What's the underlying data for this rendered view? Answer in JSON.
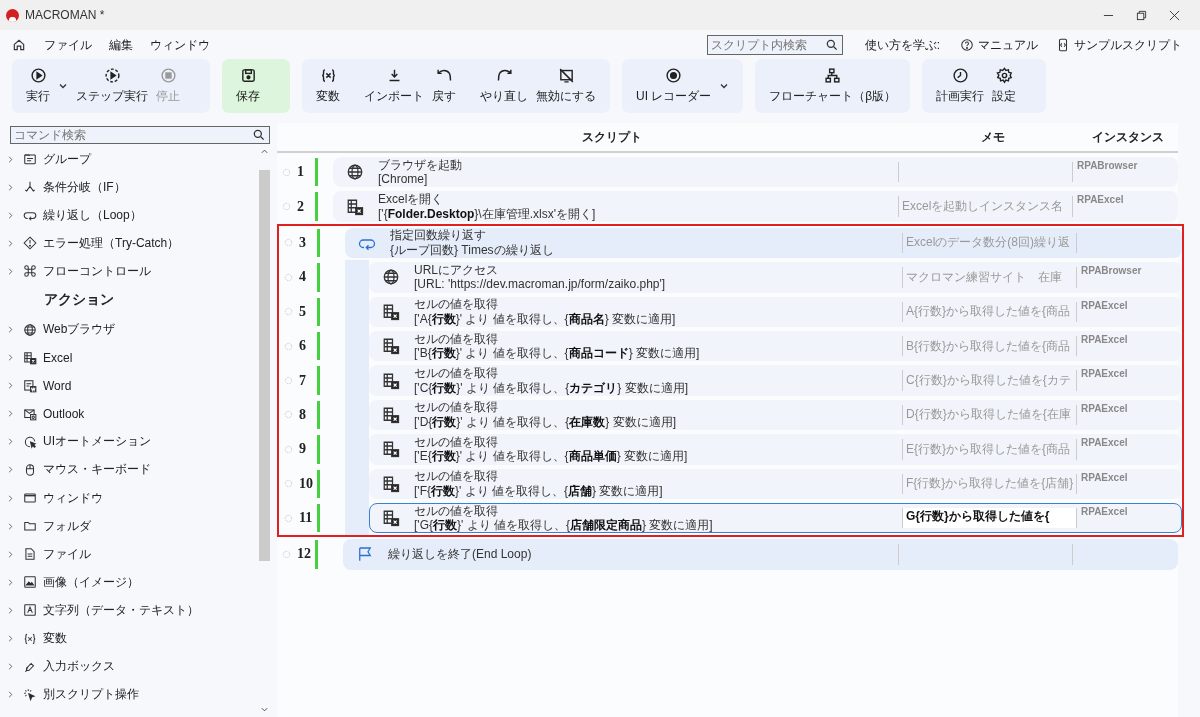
{
  "window": {
    "title": "MACROMAN *"
  },
  "menu": [
    "ファイル",
    "編集",
    "ウィンドウ"
  ],
  "script_search": {
    "placeholder": "スクリプト内検索"
  },
  "learn": {
    "label": "使い方を学ぶ:",
    "links": [
      {
        "kind": "help",
        "label": "マニュアル"
      },
      {
        "kind": "sample",
        "label": "サンプルスクリプト"
      }
    ]
  },
  "toolbar": [
    {
      "highlighted": false,
      "buttons": [
        {
          "kind": "run",
          "label": "実行",
          "dropdown": true,
          "disabled": false
        },
        {
          "kind": "step",
          "label": "ステップ実行",
          "dropdown": false,
          "disabled": false
        },
        {
          "kind": "stop",
          "label": "停止",
          "dropdown": false,
          "disabled": true
        }
      ]
    },
    {
      "highlighted": true,
      "buttons": [
        {
          "kind": "save",
          "label": "保存",
          "dropdown": false,
          "disabled": false
        }
      ]
    },
    {
      "highlighted": false,
      "buttons": [
        {
          "kind": "variable",
          "label": "変数",
          "dropdown": false,
          "disabled": false
        },
        {
          "kind": "import",
          "label": "インポート",
          "dropdown": false,
          "disabled": false
        },
        {
          "kind": "undo",
          "label": "戻す",
          "dropdown": false,
          "disabled": false
        },
        {
          "kind": "redo",
          "label": "やり直し",
          "dropdown": false,
          "disabled": false
        },
        {
          "kind": "disable",
          "label": "無効にする",
          "dropdown": false,
          "disabled": false
        }
      ]
    },
    {
      "highlighted": false,
      "buttons": [
        {
          "kind": "record",
          "label": "UI レコーダー",
          "dropdown": true,
          "disabled": false
        }
      ]
    },
    {
      "highlighted": false,
      "buttons": [
        {
          "kind": "flow",
          "label": "フローチャート（β版）",
          "dropdown": false,
          "disabled": false
        }
      ]
    },
    {
      "highlighted": false,
      "buttons": [
        {
          "kind": "schedule",
          "label": "計画実行",
          "dropdown": false,
          "disabled": false
        },
        {
          "kind": "settings",
          "label": "設定",
          "dropdown": false,
          "disabled": false
        }
      ]
    }
  ],
  "sidebar": {
    "search": {
      "placeholder": "コマンド検索"
    },
    "items": [
      {
        "kind": "group",
        "label": "グループ",
        "expanded": false
      },
      {
        "kind": "branch",
        "label": "条件分岐（IF）",
        "expanded": false
      },
      {
        "kind": "loop",
        "label": "繰り返し（Loop）",
        "expanded": false
      },
      {
        "kind": "error",
        "label": "エラー処理（Try-Catch）",
        "expanded": false
      },
      {
        "kind": "command",
        "label": "フローコントロール",
        "expanded": false
      },
      {
        "kind": "header",
        "label": "アクション"
      },
      {
        "kind": "globe",
        "label": "Webブラウザ",
        "expanded": false
      },
      {
        "kind": "excel",
        "label": "Excel",
        "expanded": false
      },
      {
        "kind": "word",
        "label": "Word",
        "expanded": false
      },
      {
        "kind": "mail",
        "label": "Outlook",
        "expanded": false
      },
      {
        "kind": "cursor",
        "label": "UIオートメーション",
        "expanded": false
      },
      {
        "kind": "mouse",
        "label": "マウス・キーボード",
        "expanded": false
      },
      {
        "kind": "window",
        "label": "ウィンドウ",
        "expanded": false
      },
      {
        "kind": "folder",
        "label": "フォルダ",
        "expanded": false
      },
      {
        "kind": "file",
        "label": "ファイル",
        "expanded": false
      },
      {
        "kind": "image",
        "label": "画像（イメージ）",
        "expanded": false
      },
      {
        "kind": "text",
        "label": "文字列（データ・テキスト）",
        "expanded": false
      },
      {
        "kind": "variable",
        "label": "変数",
        "expanded": false
      },
      {
        "kind": "pen",
        "label": "入力ボックス",
        "expanded": false
      },
      {
        "kind": "click",
        "label": "別スクリプト操作",
        "expanded": false
      }
    ]
  },
  "script": {
    "columns": [
      "スクリプト",
      "メモ",
      "インスタンス"
    ],
    "rows": [
      {
        "number": "1",
        "kind": "globe",
        "title": "ブラウザを起動",
        "detail": "[Chrome]",
        "memo": "",
        "instance": "RPABrowser",
        "selected": false
      },
      {
        "number": "2",
        "kind": "excel",
        "title": "Excelを開く",
        "detail": "['{**Folder.Desktop**}\\在庫管理.xlsx'を開く]",
        "memo": "Excelを起動しインスタンス名",
        "instance": "RPAExcel",
        "selected": false
      },
      {
        "number": "3",
        "kind": "loop",
        "title": "指定回数繰り返す",
        "detail": "{ループ回数} Timesの繰り返し",
        "memo": "Excelのデータ数分(8回)繰り返",
        "instance": "",
        "selected": false,
        "highlighted": true,
        "children": [
          {
            "number": "4",
            "kind": "globe",
            "title": "URLにアクセス",
            "detail": "[URL: 'https://dev.macroman.jp/form/zaiko.php']",
            "memo": "マクロマン練習サイト　在庫",
            "instance": "RPABrowser",
            "selected": false
          },
          {
            "number": "5",
            "kind": "excel",
            "title": "セルの値を取得",
            "detail": "['A{**行数**}' より 値を取得し、{**商品名**} 変数に適用]",
            "memo": "A{行数}から取得した値を{商品",
            "instance": "RPAExcel",
            "selected": false
          },
          {
            "number": "6",
            "kind": "excel",
            "title": "セルの値を取得",
            "detail": "['B{**行数**}' より 値を取得し、{**商品コード**} 変数に適用]",
            "memo": "B{行数}から取得した値を{商品",
            "instance": "RPAExcel",
            "selected": false
          },
          {
            "number": "7",
            "kind": "excel",
            "title": "セルの値を取得",
            "detail": "['C{**行数**}' より 値を取得し、{**カテゴリ**} 変数に適用]",
            "memo": "C{行数}から取得した値を{カテ",
            "instance": "RPAExcel",
            "selected": false
          },
          {
            "number": "8",
            "kind": "excel",
            "title": "セルの値を取得",
            "detail": "['D{**行数**}' より 値を取得し、{**在庫数**} 変数に適用]",
            "memo": "D{行数}から取得した値を{在庫",
            "instance": "RPAExcel",
            "selected": false
          },
          {
            "number": "9",
            "kind": "excel",
            "title": "セルの値を取得",
            "detail": "['E{**行数**}' より 値を取得し、{**商品単価**} 変数に適用]",
            "memo": "E{行数}から取得した値を{商品",
            "instance": "RPAExcel",
            "selected": false
          },
          {
            "number": "10",
            "kind": "excel",
            "title": "セルの値を取得",
            "detail": "['F{**行数**}' より 値を取得し、{**店舗**} 変数に適用]",
            "memo": "F{行数}から取得した値を{店舗}",
            "instance": "RPAExcel",
            "selected": false
          },
          {
            "number": "11",
            "kind": "excel",
            "title": "セルの値を取得",
            "detail": "['G{**行数**}' より 値を取得し、{**店舗限定商品**} 変数に適用]",
            "memo": "G{行数}から取得した値を{",
            "instance": "RPAExcel",
            "selected": true
          }
        ]
      },
      {
        "number": "12",
        "kind": "flag",
        "title": "繰り返しを終了(End Loop)",
        "detail": "",
        "memo": "",
        "instance": "",
        "selected": false
      }
    ]
  }
}
